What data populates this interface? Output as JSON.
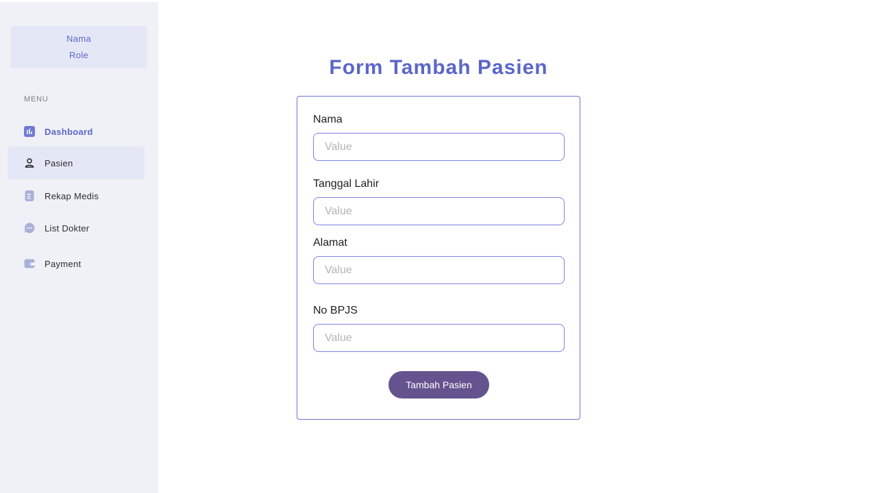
{
  "profile": {
    "name": "Nama",
    "role": "Role"
  },
  "sidebar": {
    "heading": "MENU",
    "items": [
      {
        "label": "Dashboard",
        "icon": "bar-chart-icon"
      },
      {
        "label": "Pasien",
        "icon": "user-icon"
      },
      {
        "label": "Rekap Medis",
        "icon": "document-icon"
      },
      {
        "label": "List Dokter",
        "icon": "chat-icon"
      },
      {
        "label": "Payment",
        "icon": "wallet-icon"
      }
    ]
  },
  "form": {
    "title": "Form Tambah Pasien",
    "fields": [
      {
        "label": "Nama",
        "placeholder": "Value"
      },
      {
        "label": "Tanggal Lahir",
        "placeholder": "Value"
      },
      {
        "label": "Alamat",
        "placeholder": "Value"
      },
      {
        "label": "No BPJS",
        "placeholder": "Value"
      }
    ],
    "submit_label": "Tambah Pasien"
  },
  "colors": {
    "accent": "#5b66c9",
    "button": "#65538f",
    "sidebar_bg": "#f0f1f7"
  }
}
